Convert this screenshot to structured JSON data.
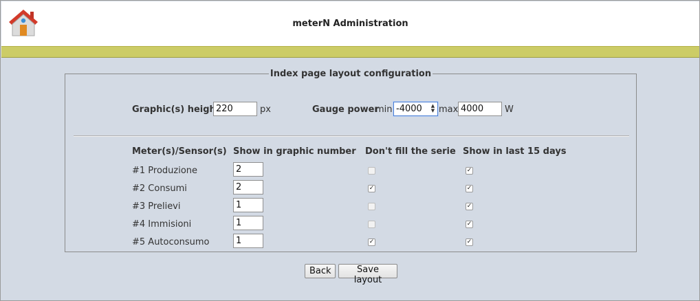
{
  "header": {
    "title": "meterN Administration",
    "logo_icon": "house-icon"
  },
  "layout_form": {
    "legend": "Index page layout configuration",
    "graphic_height_label": "Graphic(s) height",
    "graphic_height_value": "220",
    "graphic_height_unit": "px",
    "gauge_label": "Gauge power",
    "gauge_min_label": "min",
    "gauge_min_value": "-4000",
    "gauge_max_label": "max",
    "gauge_max_value": "4000",
    "gauge_unit": "W"
  },
  "table": {
    "headers": [
      "Meter(s)/Sensor(s)",
      "Show in graphic number",
      "Don't fill the serie",
      "Show in last 15 days"
    ],
    "rows": [
      {
        "name": "#1 Produzione",
        "graphic": "2",
        "nofill": false,
        "last15": true
      },
      {
        "name": "#2 Consumi",
        "graphic": "2",
        "nofill": true,
        "last15": true
      },
      {
        "name": "#3 Prelievi",
        "graphic": "1",
        "nofill": false,
        "last15": true
      },
      {
        "name": "#4 Immisioni",
        "graphic": "1",
        "nofill": false,
        "last15": true
      },
      {
        "name": "#5 Autoconsumo",
        "graphic": "1",
        "nofill": true,
        "last15": true
      }
    ]
  },
  "buttons": {
    "back": "Back",
    "save": "Save layout"
  },
  "colors": {
    "background": "#d3dae4",
    "accent_bar": "#cccc66",
    "header_bg": "#ffffff"
  }
}
